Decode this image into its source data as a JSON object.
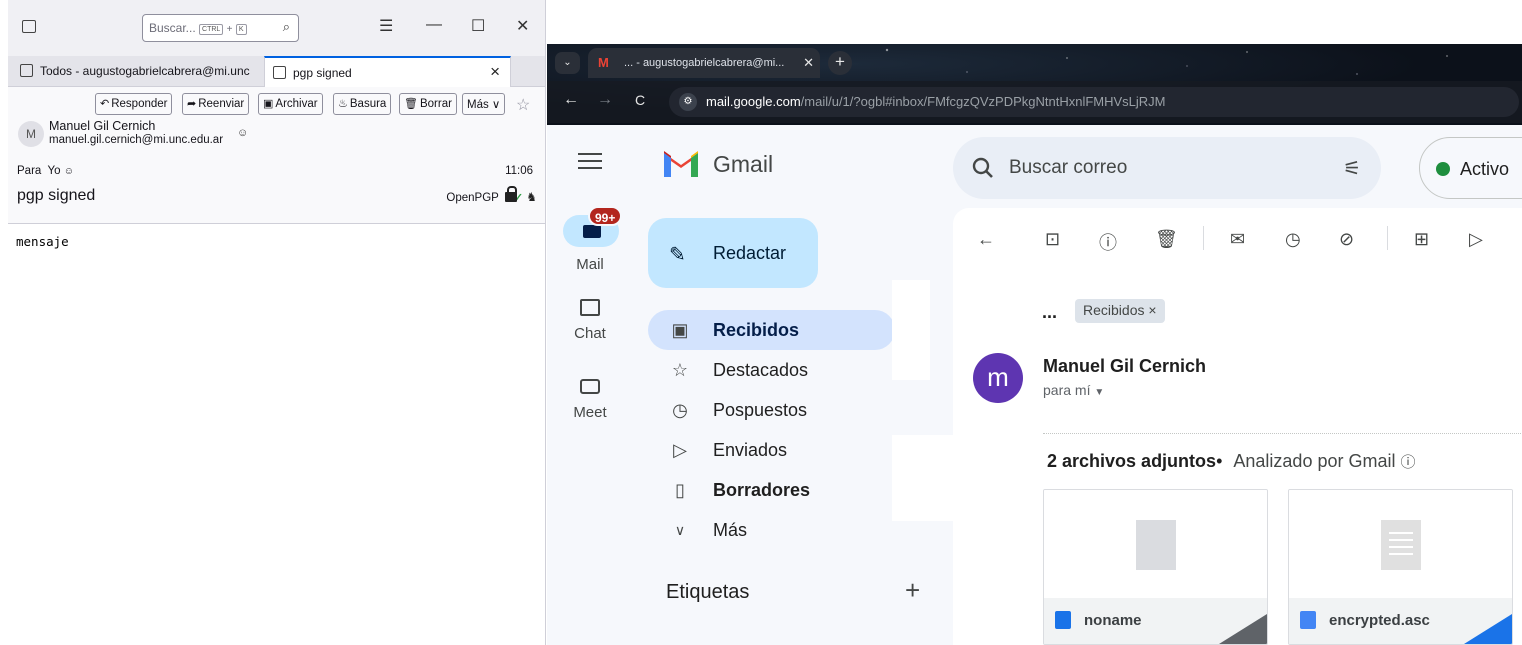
{
  "thunderbird": {
    "search": {
      "placeholder": "Buscar...",
      "key1": "CTRL",
      "plus": "+",
      "key2": "K"
    },
    "tabs": [
      {
        "label": "Todos - augustogabrielcabrera@mi.unc"
      },
      {
        "label": "pgp signed"
      }
    ],
    "tab_close": "×",
    "toolbar": {
      "reply": "Responder",
      "forward": "Reenviar",
      "archive": "Archivar",
      "junk": "Basura",
      "delete": "Borrar",
      "more": "Más"
    },
    "message": {
      "avatar_letter": "M",
      "from_name": "Manuel Gil Cernich",
      "from_email": "manuel.gil.cernich@mi.unc.edu.ar",
      "to_label": "Para",
      "to_value": "Yo",
      "time": "11:06",
      "subject": "pgp signed",
      "security_label": "OpenPGP",
      "body": "mensaje"
    }
  },
  "chrome": {
    "tab_title": "... - augustogabrielcabrera@mi...",
    "url_host": "mail.google.com",
    "url_path": "/mail/u/1/?ogbl#inbox/FMfcgzQVzPDPkgNtntHxnlFMHVsLjRJM"
  },
  "gmail": {
    "logo_text": "Gmail",
    "search_placeholder": "Buscar correo",
    "status": "Activo",
    "rail": [
      {
        "label": "Mail",
        "badge": "99+"
      },
      {
        "label": "Chat"
      },
      {
        "label": "Meet"
      }
    ],
    "compose": "Redactar",
    "nav": [
      {
        "label": "Recibidos",
        "icon": "inbox-icon",
        "active": true,
        "bold": true
      },
      {
        "label": "Destacados",
        "icon": "star-icon"
      },
      {
        "label": "Pospuestos",
        "icon": "clock-icon"
      },
      {
        "label": "Enviados",
        "icon": "send-icon"
      },
      {
        "label": "Borradores",
        "icon": "draft-icon",
        "bold": true
      },
      {
        "label": "Más",
        "icon": "chevron-down-icon"
      }
    ],
    "labels_heading": "Etiquetas",
    "labels_add": "+",
    "thread": {
      "breadcrumb": "...",
      "label_chip": "Recibidos ×",
      "sender_initial": "m",
      "sender_name": "Manuel Gil Cernich",
      "to_me": "para mí",
      "attachments_title": "2 archivos adjuntos",
      "attachments_separator": "•",
      "attachments_scan": "Analizado por Gmail",
      "attachments": [
        {
          "name": "noname",
          "icon_color": "#1a73e8"
        },
        {
          "name": "encrypted.asc",
          "icon_color": "#4285f4"
        }
      ]
    }
  }
}
